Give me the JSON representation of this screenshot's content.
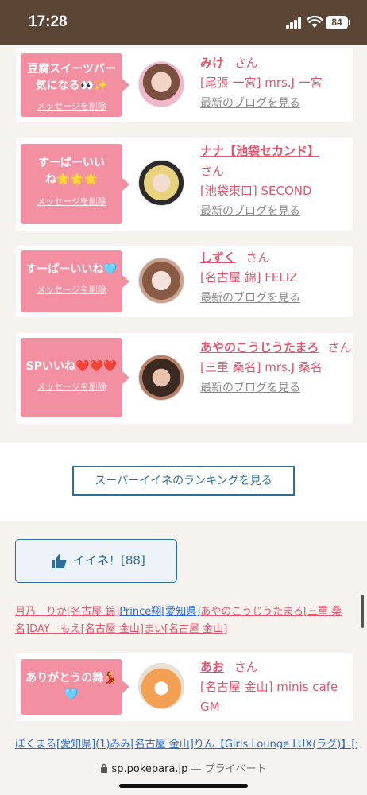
{
  "status": {
    "time": "17:28",
    "battery": "84"
  },
  "cards": [
    {
      "message": "豆腐スイーツバー気になる👀✨",
      "delete_label": "メッセージを削除",
      "name": "みけ",
      "honorific": "さん",
      "shop": "[尾張 一宮] mrs.J 一宮",
      "blog_label": "最新のブログを見る"
    },
    {
      "message": "すーぱーいいね🌟🌟🌟",
      "delete_label": "メッセージを削除",
      "name": "ナナ【池袋セカンド】",
      "honorific": "さん",
      "shop": "[池袋東口] SECOND",
      "blog_label": "最新のブログを見る"
    },
    {
      "message": "すーぱーいいね🩵",
      "delete_label": "メッセージを削除",
      "name": "しずく",
      "honorific": "さん",
      "shop": "[名古屋 錦] FELIZ",
      "blog_label": "最新のブログを見る"
    },
    {
      "message": "SPいいね❤️❤️❤️",
      "delete_label": "メッセージを削除",
      "name": "あやのこうじうたまろ",
      "honorific": "さん",
      "shop": "[三重 桑名] mrs.J 桑名",
      "blog_label": "最新のブログを見る"
    },
    {
      "message": "ありがとうの舞💃🩵",
      "delete_label": "",
      "name": "あお",
      "honorific": "さん",
      "shop": "[名古屋 金山] minis cafe GM",
      "blog_label": ""
    }
  ],
  "ranking_button": "スーパーイイネのランキングを見る",
  "like_button": {
    "label": "イイネ！",
    "count": "[88]"
  },
  "like_names": [
    {
      "text": "月乃　りか[名古屋 錦]",
      "color": "pink"
    },
    {
      "text": "Prince翔[愛知県]",
      "color": "blue"
    },
    {
      "text": "あやのこうじうたまろ[三重 桑名]",
      "color": "pink"
    },
    {
      "text": "DAY　もえ[名古屋 金山]",
      "color": "pink"
    },
    {
      "text": "まい[名古屋 金山]",
      "color": "pink"
    }
  ],
  "bottom_names": "ぽくまる[愛知県](1)みみ[名古屋 金山]りん【Girls Lounge LUX(ラグ)】[浦",
  "browser": {
    "domain": "sp.pokepara.jp",
    "mode": "— プライベート"
  },
  "colors": {
    "accent_pink": "#f28fa1",
    "link_pink": "#e0566e",
    "link_blue": "#2e6f98",
    "header_brown": "#5b4636"
  }
}
